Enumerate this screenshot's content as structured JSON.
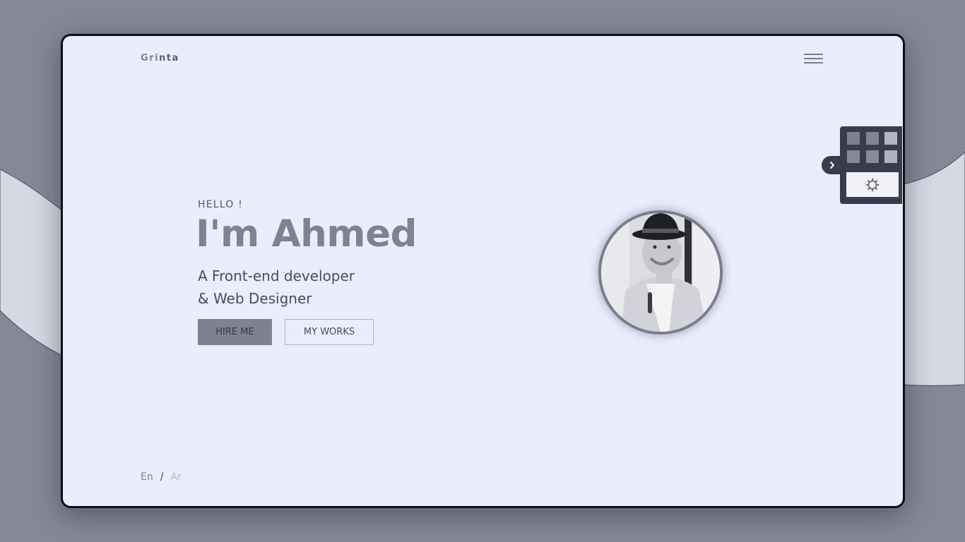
{
  "brand": {
    "logo_part1": "Gri",
    "logo_part2": "nta"
  },
  "hero": {
    "greeting": "HELLO !",
    "name": "I'm Ahmed",
    "role_line1": "A Front-end developer",
    "role_line2": "& Web Designer",
    "hire_label": "HIRE ME",
    "works_label": "MY WORKS"
  },
  "language": {
    "en": "En",
    "separator": "/",
    "ar": "Ar"
  },
  "settings": {
    "swatch_colors": [
      "#7f8190",
      "#82848f",
      "#b4b6c4",
      "#868896",
      "#898b98",
      "#afb1bf"
    ]
  },
  "icons": {
    "menu": "hamburger-menu-icon",
    "settings": "gear-icon",
    "toggle": "chevron-right-icon"
  },
  "colors": {
    "page_background": "#858897",
    "frame_background": "#eaedfd",
    "accent": "#80828f",
    "panel": "#3a3c4b"
  }
}
